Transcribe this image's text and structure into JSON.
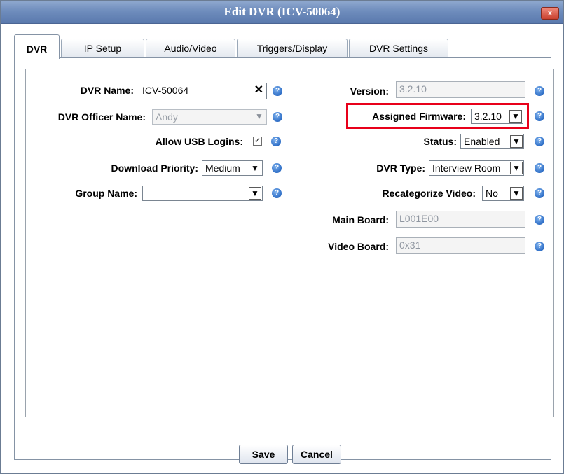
{
  "window": {
    "title": "Edit DVR (ICV-50064)",
    "close_glyph": "x"
  },
  "tabs": [
    {
      "label": "DVR",
      "active": true
    },
    {
      "label": "IP Setup"
    },
    {
      "label": "Audio/Video"
    },
    {
      "label": "Triggers/Display"
    },
    {
      "label": "DVR Settings"
    }
  ],
  "left": {
    "dvr_name": {
      "label": "DVR Name:",
      "value": "ICV-50064",
      "clear_glyph": "✕"
    },
    "officer": {
      "label": "DVR Officer Name:",
      "value": "Andy"
    },
    "usb": {
      "label": "Allow USB Logins:",
      "checked": true,
      "check_glyph": "✓"
    },
    "priority": {
      "label": "Download Priority:",
      "value": "Medium"
    },
    "group": {
      "label": "Group Name:",
      "value": ""
    }
  },
  "right": {
    "version": {
      "label": "Version:",
      "value": "3.2.10"
    },
    "firmware": {
      "label": "Assigned Firmware:",
      "value": "3.2.10"
    },
    "status": {
      "label": "Status:",
      "value": "Enabled"
    },
    "dvr_type": {
      "label": "DVR Type:",
      "value": "Interview Room"
    },
    "recategorize": {
      "label": "Recategorize Video:",
      "value": "No"
    },
    "main_board": {
      "label": "Main Board:",
      "value": "L001E00"
    },
    "video_board": {
      "label": "Video Board:",
      "value": "0x31"
    }
  },
  "help_glyph": "?",
  "arrow_glyph": "▼",
  "highlight_color": "#e8001a",
  "buttons": {
    "save": "Save",
    "cancel": "Cancel"
  }
}
